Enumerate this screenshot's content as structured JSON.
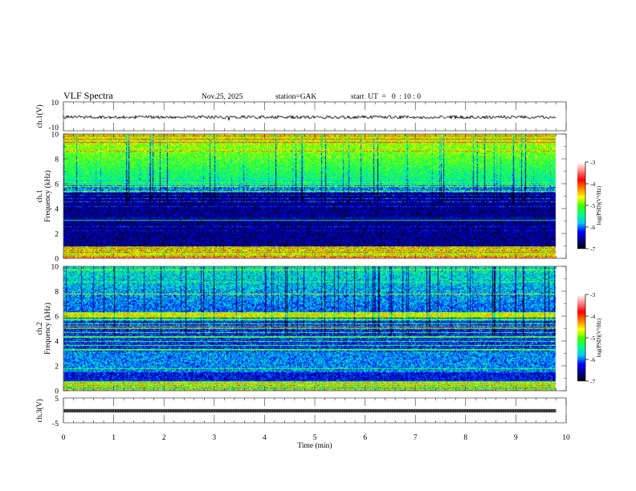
{
  "header": {
    "title": "VLF  Spectra",
    "date": "Nov.25, 2025",
    "station": "station=GAK",
    "start_ut": "start  UT  =   0  : 10 : 0"
  },
  "chart_data": [
    {
      "type": "line",
      "panel": "ch1 waveform",
      "ylabel": "ch.1(V)",
      "ylim": [
        -10,
        10
      ],
      "yticks": [
        "10",
        "-10"
      ],
      "xlim": [
        0,
        10
      ],
      "data_extent_min": 9.8,
      "baseline": 0
    },
    {
      "type": "heatmap",
      "panel": "ch1 spectrogram",
      "ylabel": "ch.1\nFrequency (kHz)",
      "ylabel_lines": [
        "ch.1",
        "Frequency  (kHz)"
      ],
      "ylim": [
        0,
        10
      ],
      "yticks": [
        "0",
        "2",
        "4",
        "6",
        "8",
        "10"
      ],
      "xlim": [
        0,
        10
      ],
      "colorbar": {
        "label": "log(PSD)(V²/Hz)",
        "range": [
          -7,
          -3
        ],
        "ticks": [
          "-3",
          "-4",
          "-5",
          "-6",
          "-7"
        ]
      }
    },
    {
      "type": "heatmap",
      "panel": "ch2 spectrogram",
      "ylabel_lines": [
        "ch.2",
        "Frequency  (kHz)"
      ],
      "ylim": [
        0,
        10
      ],
      "yticks": [
        "0",
        "2",
        "4",
        "6",
        "8",
        "10"
      ],
      "xlim": [
        0,
        10
      ],
      "colorbar": {
        "label": "log(PSD)(V²/Hz)",
        "range": [
          -7,
          -3
        ],
        "ticks": [
          "-3",
          "-4",
          "-5",
          "-6",
          "-7"
        ]
      }
    },
    {
      "type": "line",
      "panel": "ch3 waveform",
      "ylabel": "ch.3(V)",
      "ylim": [
        -5,
        5
      ],
      "yticks": [
        "5",
        "-5"
      ],
      "xlim": [
        0,
        10
      ],
      "baseline": 0
    }
  ],
  "xaxis": {
    "label": "Time  (min)",
    "ticks": [
      "0",
      "1",
      "2",
      "3",
      "4",
      "5",
      "6",
      "7",
      "8",
      "9",
      "10"
    ]
  },
  "colors": {
    "colormap": [
      "#000000",
      "#00008c",
      "#0000ff",
      "#00c8ff",
      "#00ff80",
      "#40ff00",
      "#ffff00",
      "#ff8000",
      "#ff0000",
      "#ff8080",
      "#ffffff"
    ]
  }
}
